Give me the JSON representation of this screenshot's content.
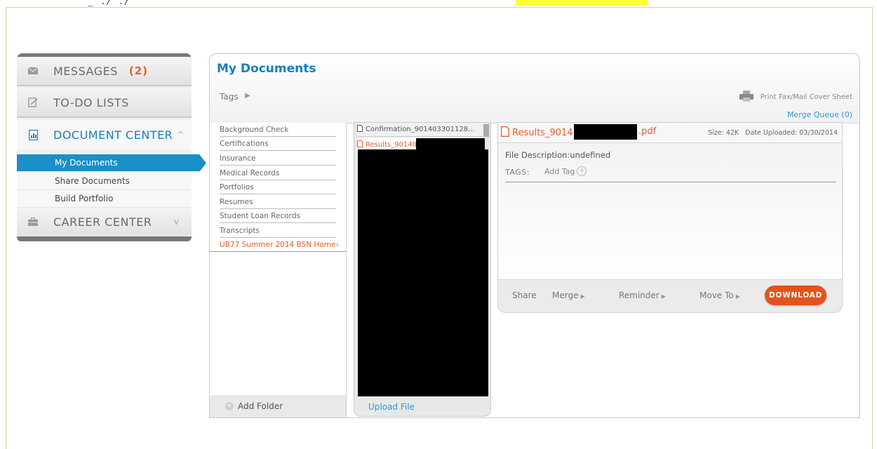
{
  "sidebar": {
    "items": [
      {
        "label": "MESSAGES",
        "count": "(2)",
        "icon": "envelope-icon"
      },
      {
        "label": "TO-DO LISTS",
        "icon": "checklist-icon"
      },
      {
        "label": "DOCUMENT CENTER",
        "icon": "document-chart-icon",
        "chevron": "^"
      },
      {
        "label": "CAREER CENTER",
        "icon": "briefcase-icon",
        "chevron": "v"
      }
    ],
    "document_subitems": [
      "My Documents",
      "Share Documents",
      "Build Portfolio"
    ]
  },
  "main": {
    "title": "My Documents",
    "tags_label": "Tags",
    "print_link": "Print Fax/Mail Cover Sheet",
    "merge_queue": "Merge Queue (0)"
  },
  "folders": {
    "items": [
      "Background Check",
      "Certifications",
      "Insurance",
      "Medical Records",
      "Portfolios",
      "Resumes",
      "Student Loan Records",
      "Transcripts",
      "UB77 Summer 2014 BSN Home"
    ],
    "add_folder": "Add Folder"
  },
  "files": {
    "items": [
      "Confirmation_901403301128...",
      "Results_90140"
    ],
    "upload": "Upload File"
  },
  "detail": {
    "file_name_prefix": "Results_9014",
    "file_ext": ".pdf",
    "size": "Size: 42K",
    "date_uploaded": "Date Uploaded: 03/30/2014",
    "description": "File Description:undefined",
    "tags_label": "TAGS:",
    "add_tag": "Add Tag",
    "actions": {
      "share": "Share",
      "merge": "Merge",
      "reminder": "Reminder",
      "move_to": "Move To",
      "download": "DOWNLOAD"
    }
  },
  "colors": {
    "accent_blue": "#1a7cc0",
    "orange": "#e0602a",
    "download_bg": "#e2541c",
    "active_nav_bg": "#1a8fc8"
  }
}
